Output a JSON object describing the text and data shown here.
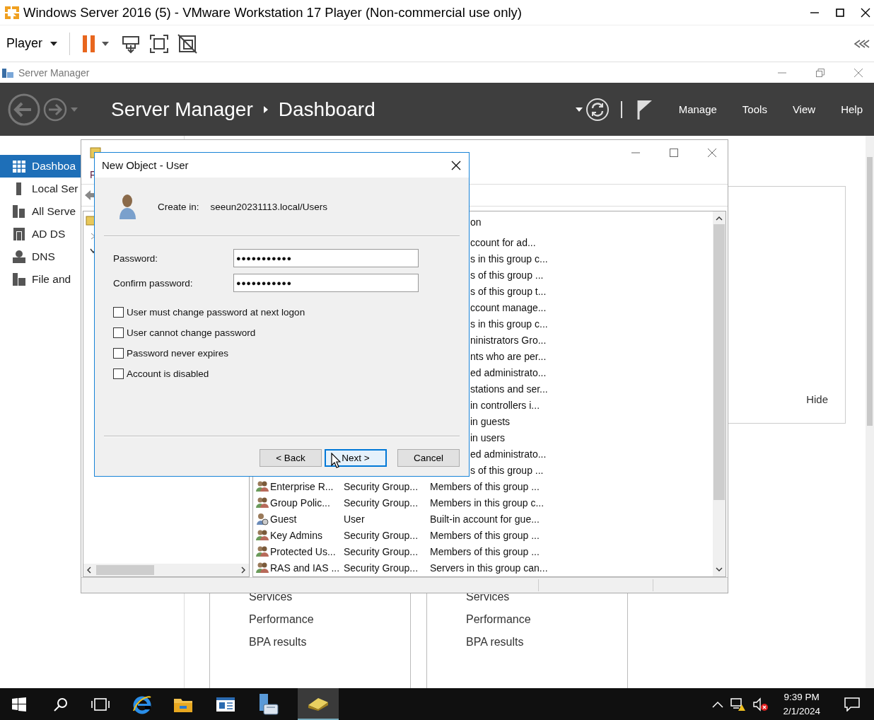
{
  "window": {
    "title": "Windows Server 2016 (5) - VMware Workstation 17 Player (Non-commercial use only)"
  },
  "toolbar": {
    "menu": "Player"
  },
  "server_manager": {
    "title": "Server Manager",
    "breadcrumb": [
      "Server Manager",
      "Dashboard"
    ],
    "menus": [
      "Manage",
      "Tools",
      "View",
      "Help"
    ],
    "sidebar": [
      {
        "label": "Dashboa",
        "selected": true,
        "kind": "dashboard"
      },
      {
        "label": "Local Ser",
        "selected": false,
        "kind": "server"
      },
      {
        "label": "All Serve",
        "selected": false,
        "kind": "servers"
      },
      {
        "label": "AD DS",
        "selected": false,
        "kind": "adds"
      },
      {
        "label": "DNS",
        "selected": false,
        "kind": "dns"
      },
      {
        "label": "File and",
        "selected": false,
        "kind": "files"
      }
    ],
    "hide_link": "Hide",
    "tiles": [
      {
        "items": [
          "Services",
          "Performance",
          "BPA results"
        ]
      },
      {
        "items": [
          "Services",
          "Performance",
          "BPA results"
        ]
      }
    ]
  },
  "aduc": {
    "menu": [
      "F"
    ],
    "list": {
      "header": "on",
      "rows": [
        {
          "description": "ccount for ad..."
        },
        {
          "description": "s in this group c..."
        },
        {
          "description": "s of this group ..."
        },
        {
          "description": "s of this group t..."
        },
        {
          "description": "ccount manage..."
        },
        {
          "description": "s in this group c..."
        },
        {
          "description": "ninistrators Gro..."
        },
        {
          "description": "nts who are per..."
        },
        {
          "description": "ed administrato..."
        },
        {
          "description": "stations and ser..."
        },
        {
          "description": "in controllers i..."
        },
        {
          "description": "in guests"
        },
        {
          "description": "in users"
        },
        {
          "description": "ed administrato..."
        },
        {
          "description": "s of this group ..."
        },
        {
          "kind": "group",
          "name": "Enterprise R...",
          "type": "Security Group...",
          "description": "Members of this group ..."
        },
        {
          "kind": "group",
          "name": "Group Polic...",
          "type": "Security Group...",
          "description": "Members in this group c..."
        },
        {
          "kind": "user",
          "name": "Guest",
          "type": "User",
          "description": "Built-in account for gue..."
        },
        {
          "kind": "group",
          "name": "Key Admins",
          "type": "Security Group...",
          "description": "Members of this group ..."
        },
        {
          "kind": "group",
          "name": "Protected Us...",
          "type": "Security Group...",
          "description": "Members of this group ..."
        },
        {
          "kind": "group",
          "name": "RAS and IAS ...",
          "type": "Security Group...",
          "description": "Servers in this group can..."
        }
      ]
    }
  },
  "dialog": {
    "title": "New Object - User",
    "create_in_label": "Create in:",
    "create_in": "seeun20231113.local/Users",
    "fields": [
      {
        "label": "Password:",
        "value": "●●●●●●●●●●●"
      },
      {
        "label": "Confirm password:",
        "value": "●●●●●●●●●●●"
      }
    ],
    "options": [
      {
        "label": "User must change password at next logon",
        "checked": false
      },
      {
        "label": "User cannot change password",
        "checked": false
      },
      {
        "label": "Password never expires",
        "checked": false
      },
      {
        "label": "Account is disabled",
        "checked": false
      }
    ],
    "buttons": [
      {
        "label": "< Back",
        "default": false
      },
      {
        "label": "Next >",
        "default": true
      },
      {
        "label": "Cancel",
        "default": false
      }
    ]
  },
  "taskbar": {
    "time": "9:39 PM",
    "date": "2/1/2024"
  }
}
